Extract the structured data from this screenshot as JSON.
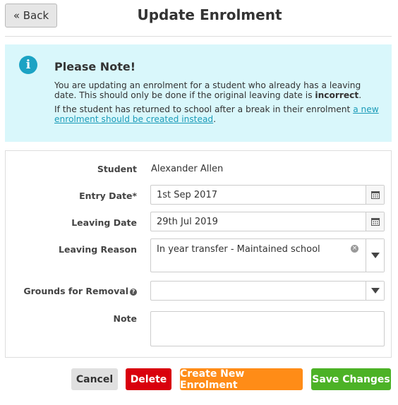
{
  "header": {
    "back_label": "« Back",
    "title": "Update Enrolment"
  },
  "note": {
    "title": "Please Note!",
    "line1_prefix": "You are updating an enrolment for a student who already has a leaving date. This should only be done if the original leaving date is ",
    "line1_bold": "incorrect",
    "line1_suffix": ".",
    "line2_prefix": "If the student has returned to school after a break in their enrolment ",
    "line2_link": "a new enrolment should be created instead",
    "line2_suffix": "."
  },
  "form": {
    "student": {
      "label": "Student",
      "value": "Alexander Allen"
    },
    "entry_date": {
      "label": "Entry Date*",
      "value": "1st Sep 2017"
    },
    "leaving_date": {
      "label": "Leaving Date",
      "value": "29th Jul 2019"
    },
    "leaving_reason": {
      "label": "Leaving Reason",
      "value": "In year transfer - Maintained school"
    },
    "grounds_for_removal": {
      "label": "Grounds for Removal",
      "value": ""
    },
    "note": {
      "label": "Note",
      "value": ""
    }
  },
  "actions": {
    "cancel": "Cancel",
    "delete": "Delete",
    "create_new": "Create New Enrolment",
    "save": "Save Changes"
  },
  "colors": {
    "note_bg": "#d9f7fb",
    "info_icon": "#1ca3c4",
    "cancel_bg": "#e0e0e0",
    "delete_bg": "#d9000d",
    "create_bg": "#ff8c17",
    "save_bg": "#4cb226"
  },
  "icons": [
    "info-icon",
    "calendar-icon",
    "clear-icon",
    "chevron-down-icon",
    "help-icon"
  ]
}
